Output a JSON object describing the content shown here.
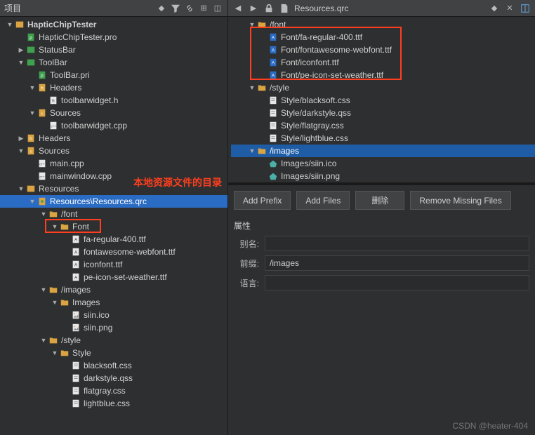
{
  "left": {
    "title": "项目",
    "tree": [
      {
        "d": 0,
        "a": "down",
        "i": "proj",
        "t": "HapticChipTester",
        "bold": true
      },
      {
        "d": 1,
        "a": "none",
        "i": "pro",
        "t": "HapticChipTester.pro"
      },
      {
        "d": 1,
        "a": "right",
        "i": "mod",
        "t": "StatusBar"
      },
      {
        "d": 1,
        "a": "down",
        "i": "mod",
        "t": "ToolBar"
      },
      {
        "d": 2,
        "a": "none",
        "i": "pro",
        "t": "ToolBar.pri"
      },
      {
        "d": 2,
        "a": "down",
        "i": "hdr",
        "t": "Headers"
      },
      {
        "d": 3,
        "a": "none",
        "i": "h",
        "t": "toolbarwidget.h"
      },
      {
        "d": 2,
        "a": "down",
        "i": "src",
        "t": "Sources"
      },
      {
        "d": 3,
        "a": "none",
        "i": "cpp",
        "t": "toolbarwidget.cpp"
      },
      {
        "d": 1,
        "a": "right",
        "i": "hdr",
        "t": "Headers"
      },
      {
        "d": 1,
        "a": "down",
        "i": "src",
        "t": "Sources"
      },
      {
        "d": 2,
        "a": "none",
        "i": "cpp",
        "t": "main.cpp"
      },
      {
        "d": 2,
        "a": "none",
        "i": "cpp",
        "t": "mainwindow.cpp"
      },
      {
        "d": 1,
        "a": "down",
        "i": "res",
        "t": "Resources"
      },
      {
        "d": 2,
        "a": "down",
        "i": "qrc",
        "t": "Resources\\Resources.qrc",
        "sel": true
      },
      {
        "d": 3,
        "a": "down",
        "i": "folder",
        "t": "/font"
      },
      {
        "d": 4,
        "a": "down",
        "i": "folder",
        "t": "Font"
      },
      {
        "d": 5,
        "a": "none",
        "i": "ttf",
        "t": "fa-regular-400.ttf"
      },
      {
        "d": 5,
        "a": "none",
        "i": "ttf",
        "t": "fontawesome-webfont.ttf"
      },
      {
        "d": 5,
        "a": "none",
        "i": "ttf",
        "t": "iconfont.ttf"
      },
      {
        "d": 5,
        "a": "none",
        "i": "ttf",
        "t": "pe-icon-set-weather.ttf"
      },
      {
        "d": 3,
        "a": "down",
        "i": "folder",
        "t": "/images"
      },
      {
        "d": 4,
        "a": "down",
        "i": "folder",
        "t": "Images"
      },
      {
        "d": 5,
        "a": "none",
        "i": "img",
        "t": "siin.ico"
      },
      {
        "d": 5,
        "a": "none",
        "i": "img",
        "t": "siin.png"
      },
      {
        "d": 3,
        "a": "down",
        "i": "folder",
        "t": "/style"
      },
      {
        "d": 4,
        "a": "down",
        "i": "folder",
        "t": "Style"
      },
      {
        "d": 5,
        "a": "none",
        "i": "css",
        "t": "blacksoft.css"
      },
      {
        "d": 5,
        "a": "none",
        "i": "css",
        "t": "darkstyle.qss"
      },
      {
        "d": 5,
        "a": "none",
        "i": "css",
        "t": "flatgray.css"
      },
      {
        "d": 5,
        "a": "none",
        "i": "css",
        "t": "lightblue.css"
      }
    ]
  },
  "right": {
    "tab": "Resources.qrc",
    "tree": [
      {
        "d": 0,
        "a": "down",
        "i": "folder",
        "t": "/font"
      },
      {
        "d": 1,
        "a": "none",
        "i": "ttfA",
        "t": "Font/fa-regular-400.ttf"
      },
      {
        "d": 1,
        "a": "none",
        "i": "ttfA",
        "t": "Font/fontawesome-webfont.ttf"
      },
      {
        "d": 1,
        "a": "none",
        "i": "ttfA",
        "t": "Font/iconfont.ttf"
      },
      {
        "d": 1,
        "a": "none",
        "i": "ttfA",
        "t": "Font/pe-icon-set-weather.ttf"
      },
      {
        "d": 0,
        "a": "down",
        "i": "folder",
        "t": "/style"
      },
      {
        "d": 1,
        "a": "none",
        "i": "css",
        "t": "Style/blacksoft.css"
      },
      {
        "d": 1,
        "a": "none",
        "i": "css",
        "t": "Style/darkstyle.qss"
      },
      {
        "d": 1,
        "a": "none",
        "i": "css",
        "t": "Style/flatgray.css"
      },
      {
        "d": 1,
        "a": "none",
        "i": "css",
        "t": "Style/lightblue.css"
      },
      {
        "d": 0,
        "a": "down",
        "i": "folder",
        "t": "/images",
        "rsel": true
      },
      {
        "d": 1,
        "a": "none",
        "i": "img2",
        "t": "Images/siin.ico"
      },
      {
        "d": 1,
        "a": "none",
        "i": "img2",
        "t": "Images/siin.png"
      }
    ],
    "buttons": {
      "add_prefix": "Add Prefix",
      "add_files": "Add Files",
      "delete": "删除",
      "remove_missing": "Remove Missing Files"
    },
    "props": {
      "title": "属性",
      "alias_label": "别名:",
      "alias_value": "",
      "prefix_label": "前缀:",
      "prefix_value": "/images",
      "lang_label": "语言:",
      "lang_value": ""
    }
  },
  "annotation": "本地资源文件的目录",
  "watermark": "CSDN @heater-404"
}
